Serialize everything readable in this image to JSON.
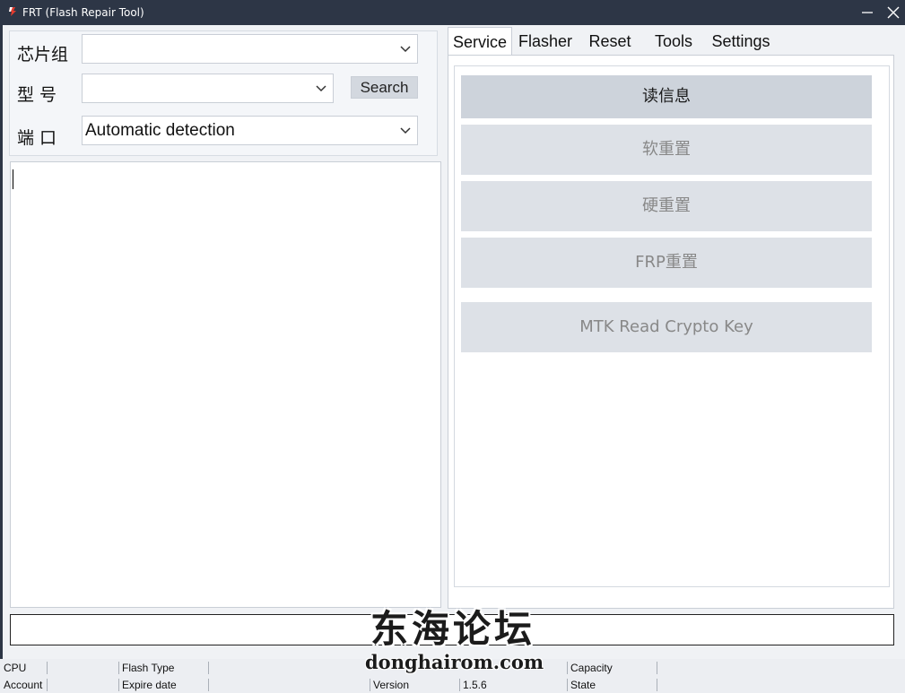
{
  "window": {
    "title": "FRT (Flash Repair Tool)"
  },
  "form": {
    "chipset_label": "芯片组",
    "chipset_value": "",
    "model_label": "型 号",
    "model_value": "",
    "search_label": "Search",
    "port_label": "端 口",
    "port_value": "Automatic detection"
  },
  "log": {
    "text": ""
  },
  "tabs": [
    {
      "label": "Service",
      "active": true
    },
    {
      "label": "Flasher",
      "active": false
    },
    {
      "label": "Reset",
      "active": false
    },
    {
      "label": "Tools",
      "active": false
    },
    {
      "label": "Settings",
      "active": false
    }
  ],
  "service": {
    "buttons": [
      {
        "label": "读信息",
        "enabled": true
      },
      {
        "label": "软重置",
        "enabled": false
      },
      {
        "label": "硬重置",
        "enabled": false
      },
      {
        "label": "FRP重置",
        "enabled": false
      },
      {
        "label": "MTK Read Crypto Key",
        "enabled": false
      }
    ]
  },
  "status": {
    "cpu_label": "CPU",
    "account_label": "Account",
    "flash_type_label": "Flash Type",
    "expire_label": "Expire date",
    "version_label": "Version",
    "version_value": "1.5.6",
    "capacity_label": "Capacity",
    "state_label": "State"
  },
  "watermark": {
    "text": "东海论坛",
    "url": "donghairom.com"
  },
  "colors": {
    "titlebar": "#2d3646",
    "button_primary": "#cdd3db",
    "button_disabled": "#dde1e7"
  }
}
